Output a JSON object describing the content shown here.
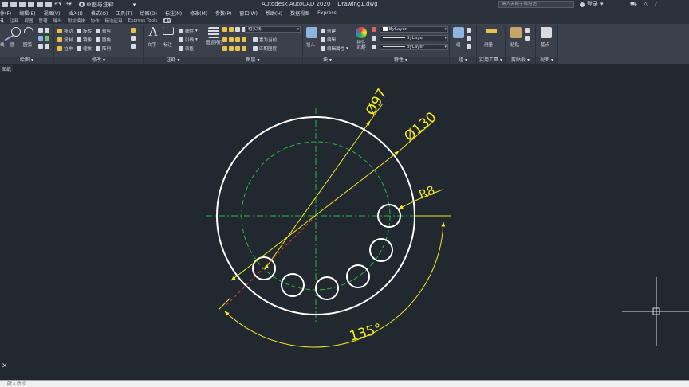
{
  "title_bar": {
    "workspace": "草图与注释",
    "app_title": "Autodesk AutoCAD 2020",
    "doc_title": "Drawing1.dwg",
    "search_placeholder": "键入关键字或短语",
    "login": "登录"
  },
  "menu": [
    "件(F)",
    "编辑(E)",
    "视图(V)",
    "插入(I)",
    "格式(O)",
    "工具(T)",
    "绘图(D)",
    "标注(N)",
    "修改(M)",
    "参数(P)",
    "窗口(W)",
    "帮助(H)",
    "数据视图",
    "Express"
  ],
  "tabs": [
    "认",
    "注释",
    "视图",
    "管理",
    "输出",
    "附加模块",
    "协作",
    "精选应用",
    "Express Tools"
  ],
  "ribbon": {
    "draw": {
      "label": "绘图",
      "tools": [
        "线",
        "圆",
        "圆弧"
      ]
    },
    "modify": {
      "label": "修改",
      "rows": [
        [
          "移动",
          "旋转",
          "修剪"
        ],
        [
          "复制",
          "镜像",
          "圆角"
        ],
        [
          "拉伸",
          "缩放",
          "阵列"
        ]
      ]
    },
    "annotate": {
      "label": "注释",
      "text": "文字",
      "dim": "标注",
      "rows": [
        "线性",
        "引线",
        "表格"
      ]
    },
    "layers": {
      "label": "图层",
      "props": "图层特性",
      "current": "粗实线",
      "set_current": "置为当前",
      "match": "匹配图层"
    },
    "block": {
      "label": "块",
      "insert": "插入",
      "create": "创建",
      "edit": "编辑",
      "edit_attr": "编辑属性"
    },
    "properties": {
      "label": "特性",
      "match": "特性匹配",
      "color": "ByLayer",
      "linetype": "ByLayer",
      "lineweight": "ByLayer"
    },
    "groups": {
      "label": "组",
      "group": "组"
    },
    "utilities": {
      "label": "实用工具",
      "measure": "测量"
    },
    "clipboard": {
      "label": "剪贴板",
      "paste": "粘贴"
    },
    "view": {
      "label": "视图",
      "base": "基点"
    }
  },
  "file_tab": "图纸",
  "drawing": {
    "dims": {
      "d1": "Ø97",
      "d2": "Ø130",
      "r": "R8",
      "angle": "135°"
    }
  },
  "command": {
    "placeholder": "键入命令"
  },
  "colors": {
    "bg": "#212830",
    "white": "#ffffff",
    "yellow": "#f2ea24",
    "green": "#2db34a",
    "red": "#e03a3a",
    "ribbon": "#3a414c"
  }
}
